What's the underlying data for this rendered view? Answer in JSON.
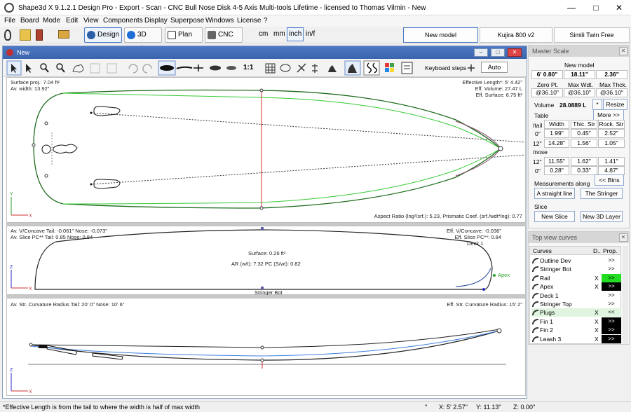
{
  "window": {
    "title": "Shape3d X 9.1.2.1 Design Pro - Export - Scan - CNC Bull Nose Disk 4-5 Axis Multi-tools Lifetime - licensed to Thomas Vilmin - New"
  },
  "menu": [
    "File",
    "Board",
    "Mode",
    "Edit",
    "View",
    "Components",
    "Display",
    "Superpose",
    "Windows",
    "License",
    "?"
  ],
  "toolbar": {
    "modes": [
      "Design",
      "3D view",
      "Plan",
      "CNC"
    ],
    "units": [
      "cm",
      "mm",
      "inch",
      "in/f"
    ],
    "active_unit": "inch",
    "models": [
      "New model",
      "Kujira 800 v2",
      "Simili Twin Free"
    ]
  },
  "doc": {
    "title": "New",
    "keyboard_steps_label": "Keyboard steps",
    "auto_label": "Auto",
    "scale_label": "1:1"
  },
  "top_view": {
    "surface_proj": "Surface proj.:  7.04 ft²",
    "av_width": "Av. width: 13.92\"",
    "effective_length": "Effective Length*: 5' 4.42\"",
    "eff_volume": "Eff. Volume:  27.47 L",
    "eff_surface": "Eff. Surface:  6.75 ft²",
    "aspect": "Aspect Ratio (lng²/srf.):  5.23,  Prismatic Coef. (srf./wdt*lng):  0.77"
  },
  "slice_view": {
    "concave_tail": "Av. V/Concave Tail: -0.061\"  Nose: -0.073\"",
    "slice_pc": "Av. Slice PC** Tail:  0.85  Nose:  0.84",
    "eff_concave": "Eff. V/Concave:  -0.036\"",
    "eff_slice_pc": "Eff. Slice PC**:  0.84",
    "deck": "Deck 1",
    "surface": "Surface:  0.26 ft²",
    "ar": "AR (w/t):  7.32  PC (S/wt):  0.82",
    "apex": "Apex",
    "stringer_bot": "Stringer Bot"
  },
  "side_view": {
    "curvature": "Av. Str. Curvature Radius Tail: 20' 0\"  Nose: 10' 6\"",
    "eff_curvature": "Eff. Str. Curvature Radius: 15' 2\""
  },
  "master_scale": {
    "title": "Master Scale",
    "model": "New model",
    "values": [
      "6' 0.80\"",
      "18.11\"",
      "2.36\""
    ],
    "labels": [
      "Zero Pt.",
      "Max Wdt.",
      "Max Thck."
    ],
    "pcts": [
      "@36.10\"",
      "@36.10\"",
      "@36.10\""
    ],
    "volume_label": "Volume",
    "volume": "28.0889 L",
    "star": "*",
    "resize": "Resize",
    "table_label": "Table",
    "more": "More >>",
    "headers": [
      "Width",
      "Thic. Str",
      "Rock. Str"
    ],
    "tail_label": "/tail",
    "nose_label": "/nose",
    "rows_tail": [
      [
        "0\"",
        "1.99\"",
        "0.45\"",
        "2.52\""
      ],
      [
        "12\"",
        "14.28\"",
        "1.56\"",
        "1.05\""
      ]
    ],
    "rows_nose": [
      [
        "12\"",
        "11.55\"",
        "1.62\"",
        "1.41\""
      ],
      [
        "0\"",
        "0.28\"",
        "0.33\"",
        "4.87\""
      ]
    ],
    "btns": "<< Btns",
    "meas_label": "Measurements along",
    "straight": "A straight line",
    "stringer": "The Stringer",
    "slice_label": "Slice",
    "new_slice": "New Slice",
    "new_3d": "New 3D Layer"
  },
  "curves": {
    "title": "Top view curves",
    "col_curves": "Curves",
    "col_d": "D..",
    "col_prop": "Prop.",
    "items": [
      {
        "name": "Outline Dev",
        "check": "",
        "prop": ">>",
        "style": "plain"
      },
      {
        "name": "Stringer Bot",
        "check": "",
        "prop": ">>",
        "style": "plain"
      },
      {
        "name": "Rail",
        "check": "X",
        "prop": ">>",
        "style": "green"
      },
      {
        "name": "Apex",
        "check": "X",
        "prop": ">>",
        "style": "black"
      },
      {
        "name": "Deck 1",
        "check": "",
        "prop": ">>",
        "style": "plain"
      },
      {
        "name": "Stringer Top",
        "check": "",
        "prop": ">>",
        "style": "plain"
      },
      {
        "name": "Plugs",
        "check": "X",
        "prop": "<<",
        "style": "hl"
      },
      {
        "name": "Fin 1",
        "check": "X",
        "prop": ">>",
        "style": "black"
      },
      {
        "name": "Fin 2",
        "check": "X",
        "prop": ">>",
        "style": "black"
      },
      {
        "name": "Leash 3",
        "check": "X",
        "prop": ">>",
        "style": "black"
      }
    ]
  },
  "status": {
    "hint": "*Effective Length is from the tail to where the width is half of max width",
    "mark": "\"",
    "x": "X: 5' 2.57\"",
    "y": "Y: 11.13\"",
    "z": "Z: 0.00\""
  },
  "colors": {
    "accent": "#3a64ad",
    "rail": "#2aa02a",
    "curve": "#8d4b6f"
  }
}
